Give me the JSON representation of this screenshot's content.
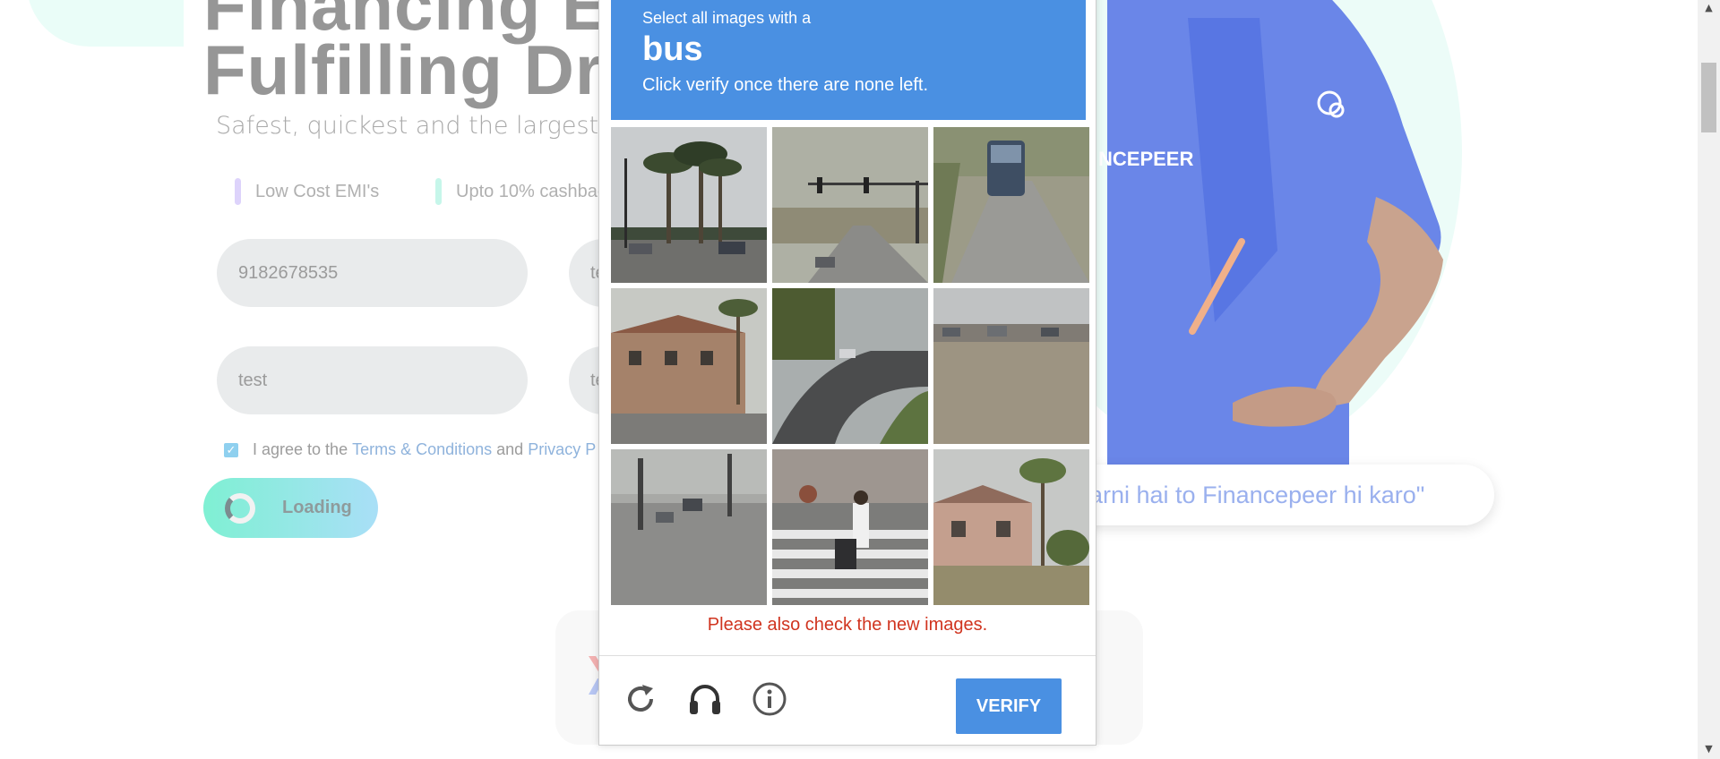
{
  "hero": {
    "title_line1": "Financing Ed",
    "title_line2": "Fulfilling Dre",
    "subtitle": "Safest, quickest and the largest edu",
    "features": [
      "Low Cost EMI's",
      "Upto 10% cashbac"
    ]
  },
  "form": {
    "phone_value": "9182678535",
    "field2_value": "te",
    "field3_value": "test",
    "field4_value": "te",
    "agree_prefix": "I agree to the",
    "terms_link": "Terms & Conditions",
    "and_text": "and",
    "privacy_link": "Privacy P",
    "checkbox_mark": "✓",
    "submit_label": "Loading"
  },
  "promo": {
    "brand_text": "NCEPEER",
    "slogan": "arni hai to Financepeer hi karo\""
  },
  "captcha": {
    "instruction": "Select all images with a",
    "keyword": "bus",
    "subinstruction": "Click verify once there are none left.",
    "error_message": "Please also check the new images.",
    "verify_label": "VERIFY",
    "tiles": [
      "palm trees street",
      "traffic light road",
      "bus on road",
      "building with palm trees",
      "curving road",
      "parking lot",
      "street intersection",
      "crosswalk with pedestrians",
      "house with trees"
    ]
  },
  "colors": {
    "captcha_blue": "#4a90e2",
    "error_red": "#d0341f",
    "field_gray": "#e9ebec",
    "accent_mint": "#7ff0d3",
    "slogan_blue": "#9ab0ee"
  },
  "icons": {
    "reload": "reload-icon",
    "audio": "headphones-icon",
    "info": "info-icon",
    "scroll_up": "▲",
    "scroll_down": "▼"
  }
}
